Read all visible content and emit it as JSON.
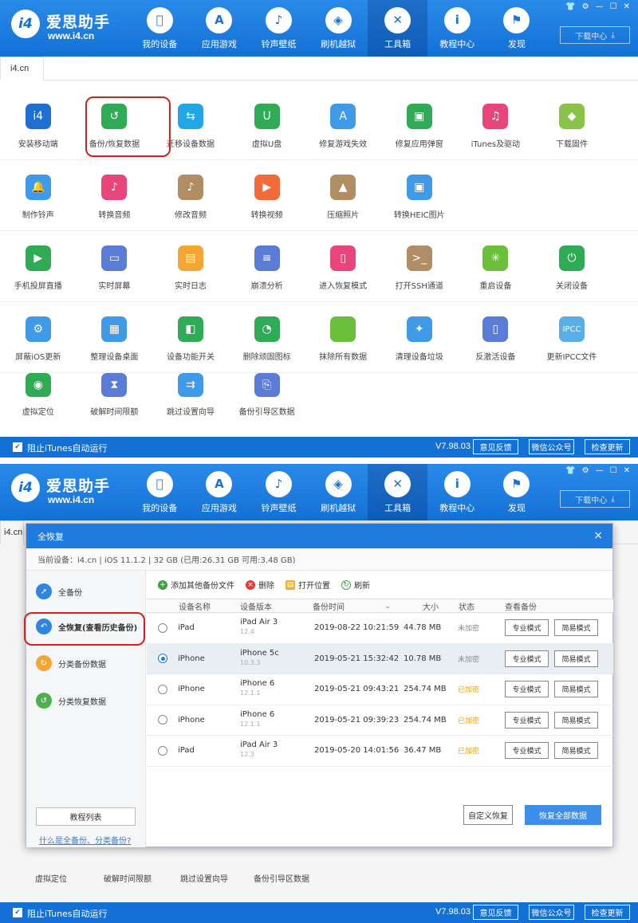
{
  "app": {
    "brand": "爱思助手",
    "url": "www.i4.cn",
    "logo_text": "i4",
    "nav": [
      {
        "label": "我的设备",
        "icon": "apple-icon"
      },
      {
        "label": "应用游戏",
        "icon": "appstore-icon"
      },
      {
        "label": "铃声壁纸",
        "icon": "music-icon"
      },
      {
        "label": "刷机越狱",
        "icon": "box-icon"
      },
      {
        "label": "工具箱",
        "icon": "tools-icon"
      },
      {
        "label": "教程中心",
        "icon": "info-icon"
      },
      {
        "label": "发现",
        "icon": "flag-icon"
      }
    ],
    "active_nav": "工具箱",
    "download_center": "下载中心",
    "tab": "i4.cn"
  },
  "tools": [
    [
      "安装移动端",
      "备份/恢复数据",
      "迁移设备数据",
      "虚拟U盘",
      "修复游戏失效",
      "修复应用弹窗",
      "iTunes及驱动",
      "下载固件"
    ],
    [
      "制作铃声",
      "转换音频",
      "修改音频",
      "转换视频",
      "压缩照片",
      "转换HEIC图片"
    ],
    [
      "手机投屏直播",
      "实时屏幕",
      "实时日志",
      "崩溃分析",
      "进入恢复模式",
      "打开SSH通道",
      "重启设备",
      "关闭设备"
    ],
    [
      "屏蔽iOS更新",
      "整理设备桌面",
      "设备功能开关",
      "删除顽固图标",
      "抹除所有数据",
      "清理设备垃圾",
      "反激活设备",
      "更新IPCC文件"
    ],
    [
      "虚拟定位",
      "破解时间限额",
      "跳过设置向导",
      "备份引导区数据"
    ]
  ],
  "footer": {
    "block_itunes": "阻止iTunes自动运行",
    "version": "V7.98.03",
    "feedback": "意见反馈",
    "wechat": "微信公众号",
    "update": "检查更新"
  },
  "dialog": {
    "title": "全恢复",
    "close": "×",
    "device_info": "当前设备：i4.cn  |  iOS 11.1.2  |  32 GB (已用:26.31 GB 可用:3.48 GB)",
    "sidebar": [
      "全备份",
      "全恢复(查看历史备份)",
      "分类备份数据",
      "分类恢复数据"
    ],
    "tutorial_btn": "教程列表",
    "help_link": "什么是全备份、分类备份?",
    "toolbar": {
      "add": "添加其他备份文件",
      "delete": "删除",
      "open": "打开位置",
      "refresh": "刷新"
    },
    "columns": [
      "设备名称",
      "设备版本",
      "备份时间",
      "大小",
      "状态",
      "查看备份"
    ],
    "rows": [
      {
        "name": "iPad",
        "model": "iPad Air 3",
        "ios": "12.4",
        "time": "2019-08-22 10:21:59",
        "size": "44.78 MB",
        "status": "未加密",
        "encrypted": false,
        "selected": false
      },
      {
        "name": "iPhone",
        "model": "iPhone 5c",
        "ios": "10.3.3",
        "time": "2019-05-21 15:32:42",
        "size": "10.78 MB",
        "status": "未加密",
        "encrypted": false,
        "selected": true
      },
      {
        "name": "iPhone",
        "model": "iPhone 6",
        "ios": "12.1.1",
        "time": "2019-05-21 09:43:21",
        "size": "254.74 MB",
        "status": "已加密",
        "encrypted": true,
        "selected": false
      },
      {
        "name": "iPhone",
        "model": "iPhone 6",
        "ios": "12.1.1",
        "time": "2019-05-21 09:39:23",
        "size": "254.74 MB",
        "status": "已加密",
        "encrypted": true,
        "selected": false
      },
      {
        "name": "iPad",
        "model": "iPad Air 3",
        "ios": "12.3",
        "time": "2019-05-20 14:01:56",
        "size": "36.47 MB",
        "status": "已加密",
        "encrypted": true,
        "selected": false
      }
    ],
    "pro_mode": "专业模式",
    "simple_mode": "简易模式",
    "custom_restore": "自定义恢复",
    "restore_all": "恢复全部数据"
  },
  "colors": {
    "accent": "#1371d6",
    "encrypted": "#f0a000",
    "highlight": "#d42020"
  }
}
